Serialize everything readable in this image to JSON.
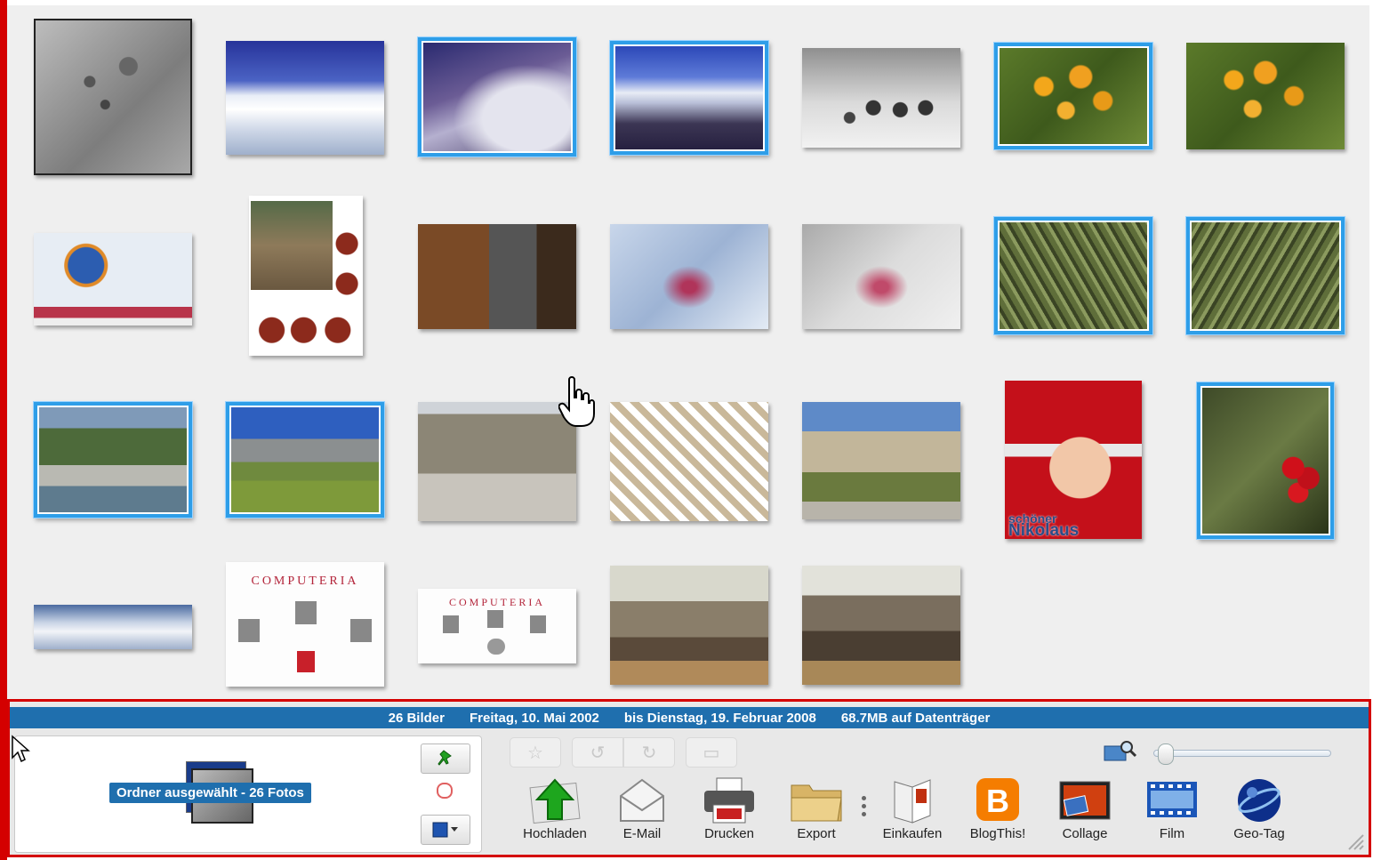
{
  "status": {
    "count": "26 Bilder",
    "from": "Freitag, 10. Mai 2002",
    "to": "bis Dienstag, 19. Februar 2008",
    "size": "68.7MB auf Datenträger"
  },
  "folder": {
    "label": "Ordner ausgewählt - 26 Fotos"
  },
  "thumbnails": [
    {
      "name": "thumb-micrograph-cell",
      "selected": false
    },
    {
      "name": "thumb-snow-landscape",
      "selected": false
    },
    {
      "name": "thumb-mountain-clouds",
      "selected": true
    },
    {
      "name": "thumb-alpine-valley",
      "selected": true
    },
    {
      "name": "thumb-micrograph-particles",
      "selected": false
    },
    {
      "name": "thumb-orange-flowers-1",
      "selected": true
    },
    {
      "name": "thumb-orange-flowers-2",
      "selected": false
    },
    {
      "name": "thumb-thunderbird-portable",
      "selected": false
    },
    {
      "name": "thumb-collage-room",
      "selected": false
    },
    {
      "name": "thumb-stove-room",
      "selected": false
    },
    {
      "name": "thumb-embroidery-1",
      "selected": false
    },
    {
      "name": "thumb-embroidery-2",
      "selected": false
    },
    {
      "name": "thumb-green-plants-1",
      "selected": true
    },
    {
      "name": "thumb-green-plants-2",
      "selected": true
    },
    {
      "name": "thumb-rock-forest",
      "selected": true
    },
    {
      "name": "thumb-mountain-meadow",
      "selected": true
    },
    {
      "name": "thumb-arcade-courtyard",
      "selected": false
    },
    {
      "name": "thumb-mosaic-tiles",
      "selected": false
    },
    {
      "name": "thumb-arcade-garden",
      "selected": false
    },
    {
      "name": "thumb-baby-nikolaus",
      "selected": false,
      "caption_line1": "schöner",
      "caption_line2": "Nikolaus"
    },
    {
      "name": "thumb-red-berries",
      "selected": true
    },
    {
      "name": "thumb-snow-panorama",
      "selected": false
    },
    {
      "name": "thumb-computeria-logo-1",
      "selected": false,
      "caption": "COMPUTERIA"
    },
    {
      "name": "thumb-computeria-logo-2",
      "selected": false,
      "caption": "COMPUTERIA"
    },
    {
      "name": "thumb-meeting-room-1",
      "selected": false
    },
    {
      "name": "thumb-meeting-room-2",
      "selected": false
    }
  ],
  "tools": [
    {
      "name": "upload-button",
      "icon": "upload-arrow-icon",
      "label": "Hochladen"
    },
    {
      "name": "email-button",
      "icon": "envelope-icon",
      "label": "E-Mail"
    },
    {
      "name": "print-button",
      "icon": "printer-icon",
      "label": "Drucken"
    },
    {
      "name": "export-button",
      "icon": "folder-icon",
      "label": "Export"
    },
    {
      "name": "shop-button",
      "icon": "book-icon",
      "label": "Einkaufen"
    },
    {
      "name": "blogthis-button",
      "icon": "blogger-icon",
      "label": "BlogThis!"
    },
    {
      "name": "collage-button",
      "icon": "collage-icon",
      "label": "Collage"
    },
    {
      "name": "film-button",
      "icon": "film-strip-icon",
      "label": "Film"
    },
    {
      "name": "geotag-button",
      "icon": "globe-icon",
      "label": "Geo-Tag"
    }
  ],
  "zoom": {
    "level": 0.02
  },
  "colors": {
    "accent": "#1f6fae",
    "selection": "#2e9ee8",
    "frame": "#d40000"
  }
}
